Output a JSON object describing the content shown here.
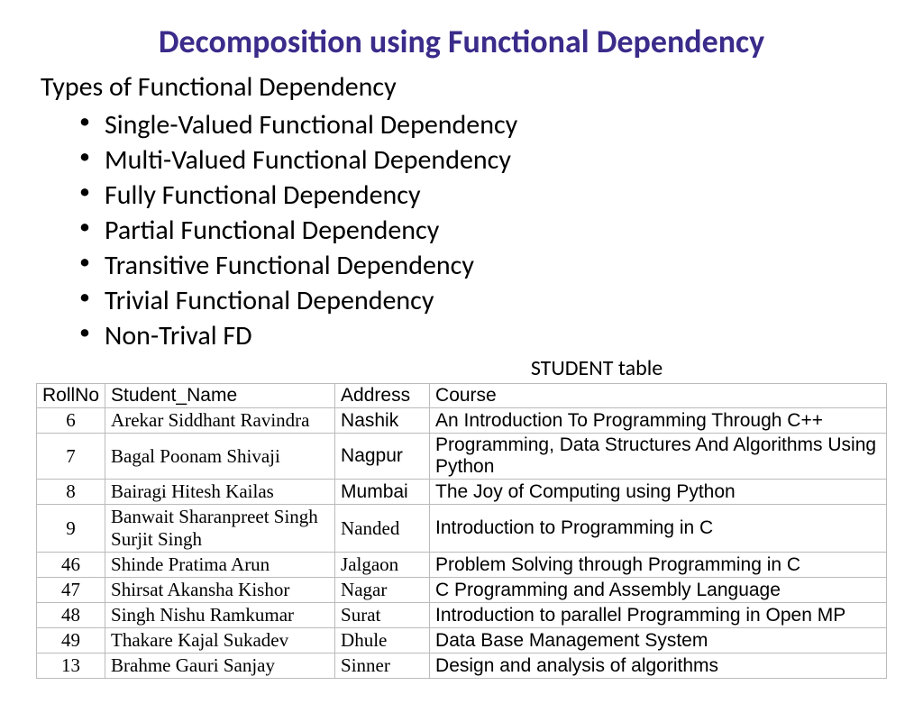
{
  "title": "Decomposition using Functional Dependency",
  "subtitle": "Types of Functional Dependency",
  "types": [
    "Single-Valued Functional Dependency",
    "Multi-Valued Functional Dependency",
    "Fully Functional Dependency",
    "Partial Functional Dependency",
    "Transitive Functional Dependency",
    "Trivial Functional Dependency",
    "Non-Trival FD"
  ],
  "table_title": "STUDENT table",
  "headers": [
    "RollNo",
    "Student_Name",
    "Address",
    "Course"
  ],
  "rows": [
    {
      "rollno": "6",
      "name": "Arekar Siddhant Ravindra",
      "address": "Nashik",
      "addr_sans": true,
      "course": "An Introduction To Programming Through C++"
    },
    {
      "rollno": "7",
      "name": "Bagal Poonam Shivaji",
      "address": "Nagpur",
      "addr_sans": true,
      "course": "Programming, Data Structures And Algorithms Using Python"
    },
    {
      "rollno": "8",
      "name": "Bairagi Hitesh Kailas",
      "address": "Mumbai",
      "addr_sans": true,
      "course": "The Joy of Computing using Python"
    },
    {
      "rollno": "9",
      "name": "Banwait Sharanpreet Singh Surjit Singh",
      "address": "Nanded",
      "addr_sans": false,
      "course": "Introduction to Programming in C"
    },
    {
      "rollno": "46",
      "name": "Shinde Pratima Arun",
      "address": "Jalgaon",
      "addr_sans": false,
      "course": "Problem Solving through Programming in C"
    },
    {
      "rollno": "47",
      "name": "Shirsat Akansha Kishor",
      "address": "Nagar",
      "addr_sans": false,
      "course": "C Programming and Assembly Language"
    },
    {
      "rollno": "48",
      "name": "Singh Nishu Ramkumar",
      "address": "Surat",
      "addr_sans": false,
      "course": "Introduction to parallel Programming in Open MP"
    },
    {
      "rollno": "49",
      "name": "Thakare Kajal Sukadev",
      "address": "Dhule",
      "addr_sans": false,
      "course": "Data Base Management System"
    },
    {
      "rollno": "13",
      "name": "Brahme Gauri Sanjay",
      "address": "Sinner",
      "addr_sans": false,
      "course": "Design and analysis of algorithms"
    }
  ]
}
